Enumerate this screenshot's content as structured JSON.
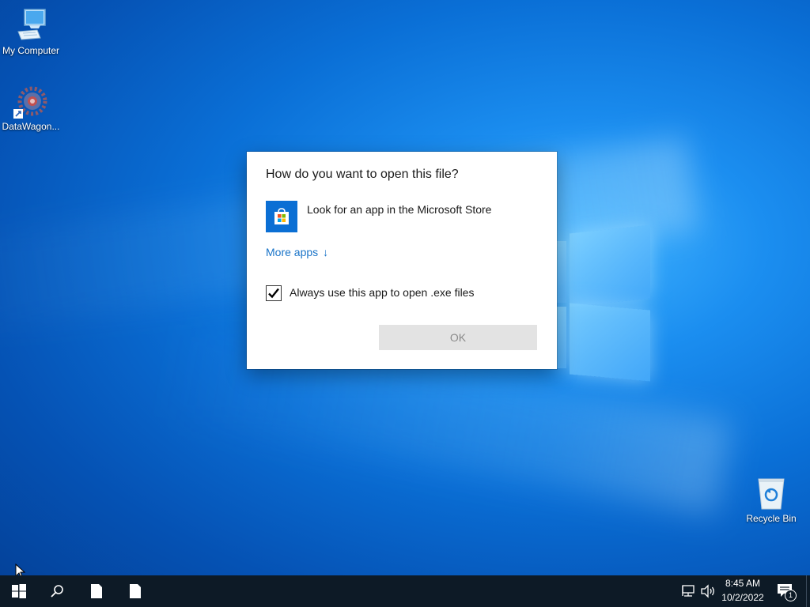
{
  "desktop": {
    "icons": [
      {
        "label": "My Computer"
      },
      {
        "label": "DataWagon..."
      },
      {
        "label": "Recycle Bin"
      }
    ]
  },
  "dialog": {
    "title": "How do you want to open this file?",
    "store_option": "Look for an app in the Microsoft Store",
    "more_apps": "More apps",
    "checkbox_label": "Always use this app to open .exe files",
    "checkbox_checked": true,
    "ok_label": "OK",
    "ok_enabled": false
  },
  "taskbar": {
    "clock_time": "8:45 AM",
    "clock_date": "10/2/2022",
    "notification_count": "1"
  },
  "colors": {
    "accent": "#0b6fd4",
    "link": "#1a74c8",
    "taskbar": "#0d1a26"
  }
}
